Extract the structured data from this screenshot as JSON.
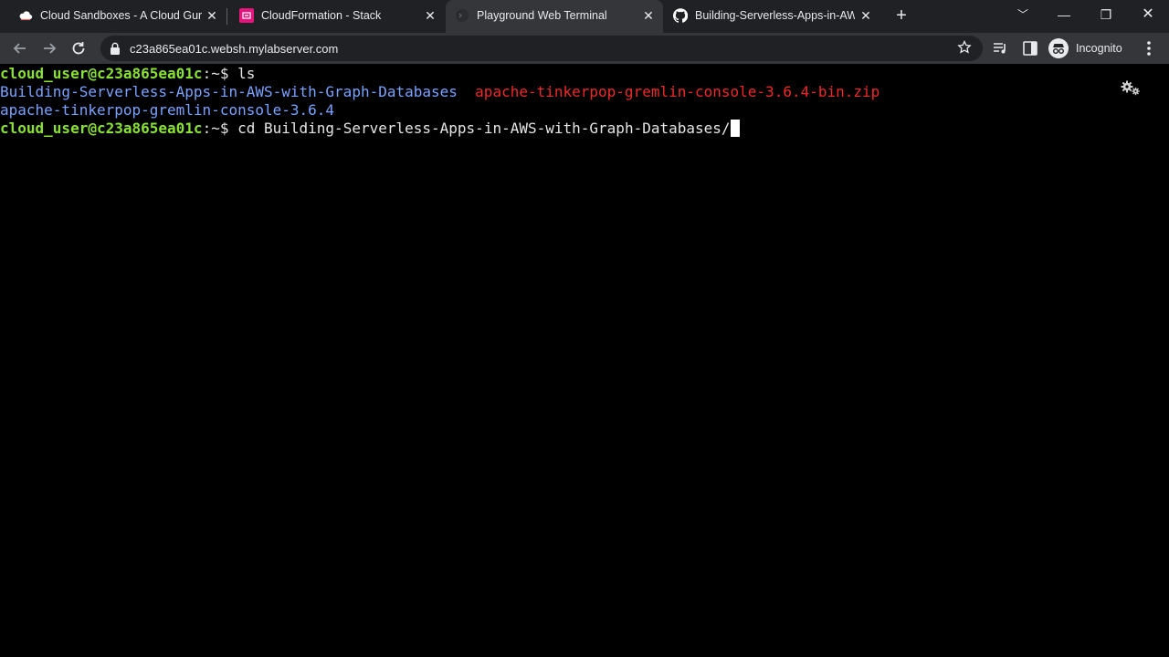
{
  "tabs": [
    {
      "title": "Cloud Sandboxes - A Cloud Guru",
      "icon": "cloud-icon",
      "active": false
    },
    {
      "title": "CloudFormation - Stack",
      "icon": "cloudformation-icon",
      "active": false
    },
    {
      "title": "Playground Web Terminal",
      "icon": "terminal-icon",
      "active": true
    },
    {
      "title": "Building-Serverless-Apps-in-AWS-with-Graph-Databases",
      "icon": "github-icon",
      "active": false
    }
  ],
  "toolbar": {
    "url": "c23a865ea01c.websh.mylabserver.com",
    "profile_label": "Incognito"
  },
  "terminal": {
    "lines": [
      {
        "prompt": "cloud_user@c23a865ea01c",
        "path": ":~$ ",
        "command": "ls"
      },
      {
        "dir1": "Building-Serverless-Apps-in-AWS-with-Graph-Databases",
        "zip": "apache-tinkerpop-gremlin-console-3.6.4-bin.zip"
      },
      {
        "dir2": "apache-tinkerpop-gremlin-console-3.6.4"
      },
      {
        "prompt": "cloud_user@c23a865ea01c",
        "path": ":~$ ",
        "command": "cd Building-Serverless-Apps-in-AWS-with-Graph-Databases/"
      }
    ]
  },
  "colors": {
    "prompt": "#8ae234",
    "directory": "#7aa2ff",
    "archive": "#ef2929",
    "tabstrip": "#202124",
    "toolbar": "#35363a"
  }
}
